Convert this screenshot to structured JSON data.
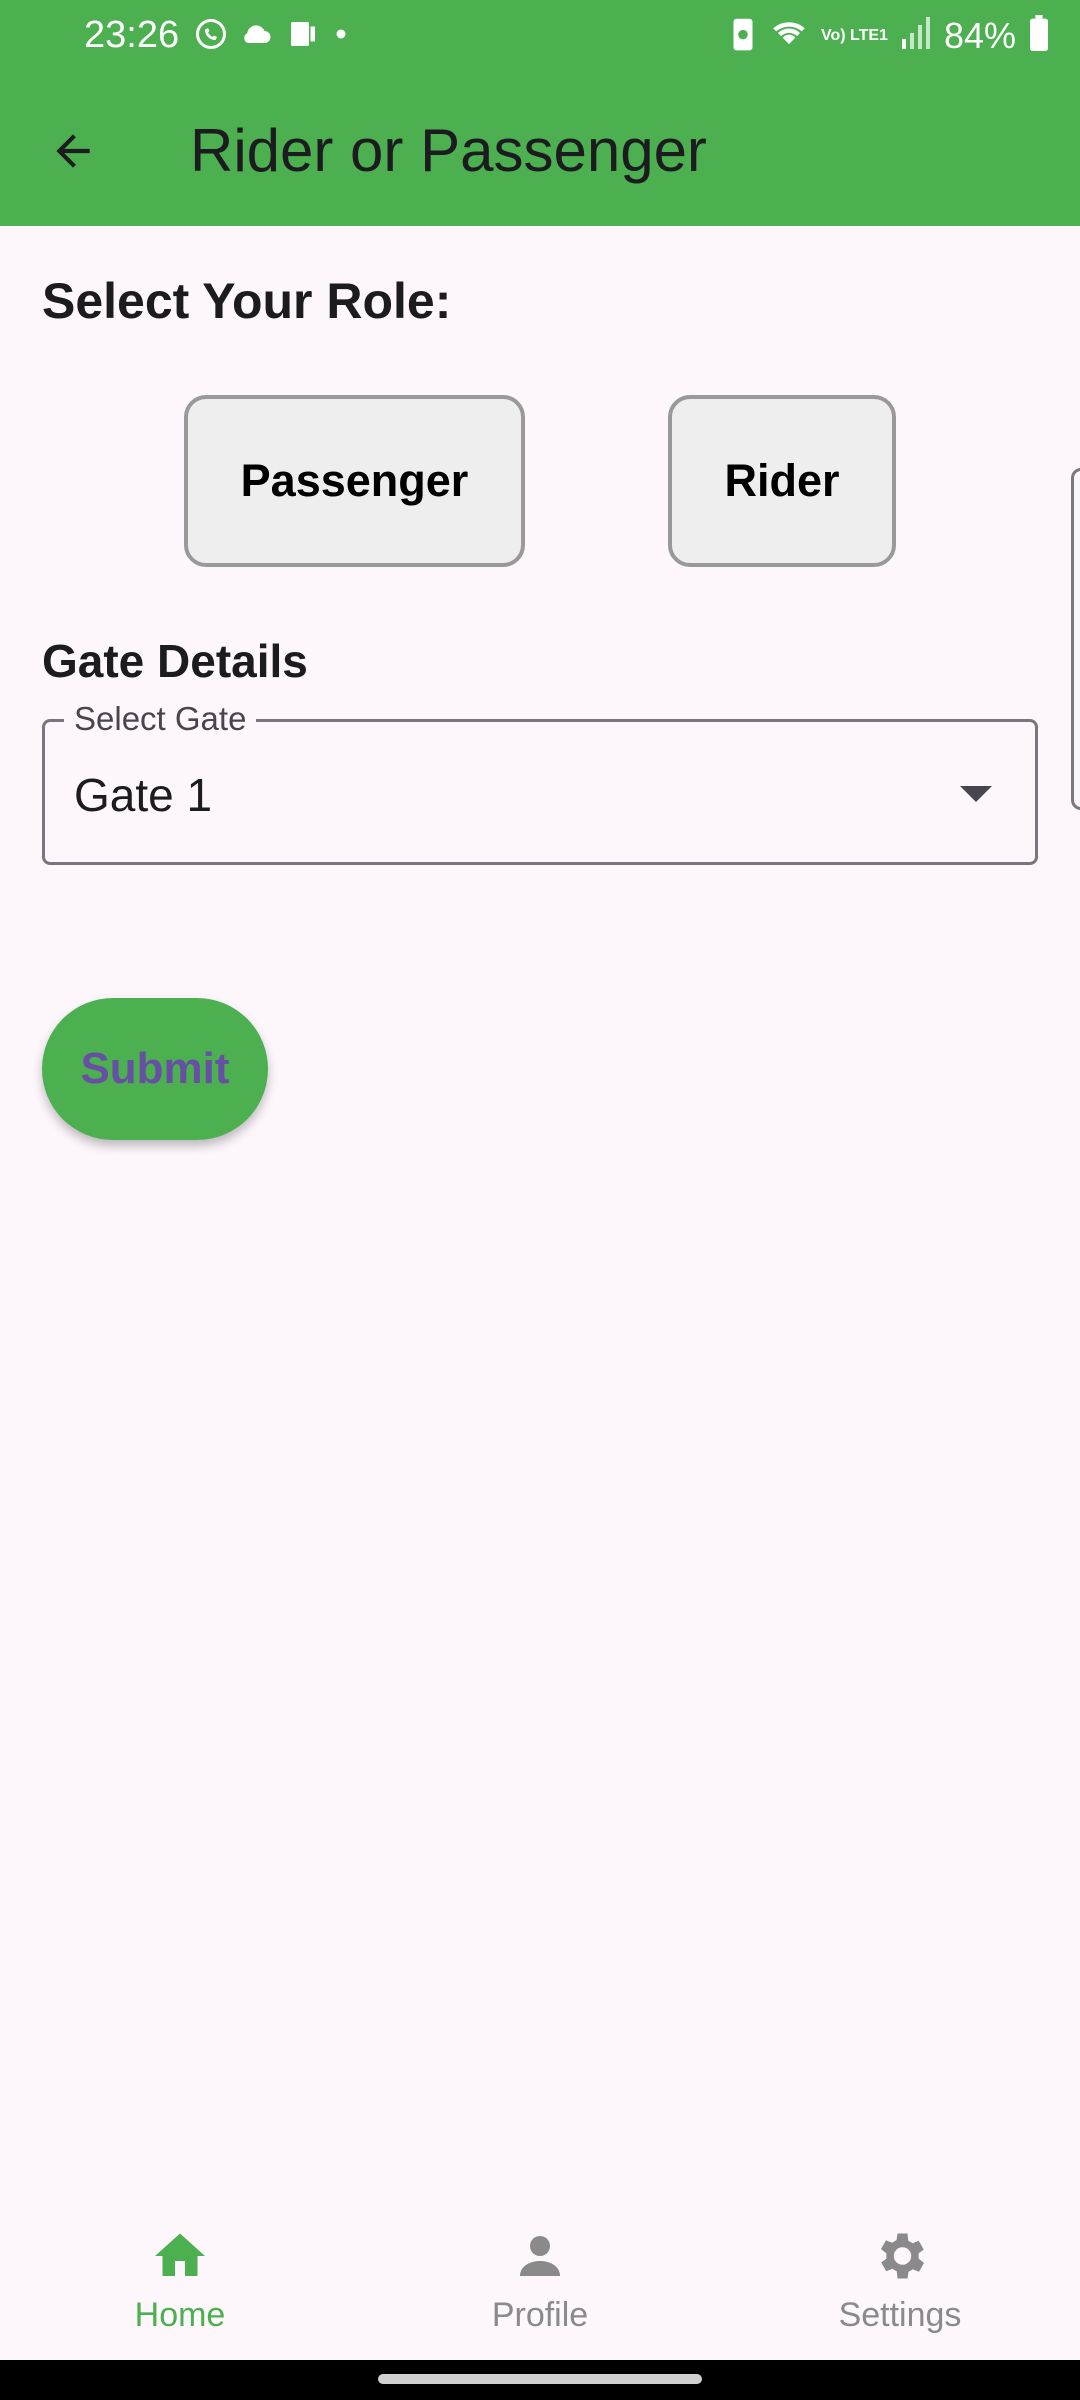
{
  "status_bar": {
    "time": "23:26",
    "battery": "84%",
    "icons_left": [
      "whatsapp-icon",
      "cloud-icon",
      "device-icon",
      "dot-icon"
    ],
    "icons_right": [
      "battery-saver-icon",
      "wifi-icon",
      "volte-icon",
      "signal-icon",
      "battery-icon"
    ],
    "volte_text": "Vo) LTE1"
  },
  "app_bar": {
    "title": "Rider or Passenger",
    "back_icon": "back-arrow-icon",
    "color": "#4caf50"
  },
  "role_section": {
    "heading": "Select Your Role:",
    "options": [
      {
        "label": "Passenger"
      },
      {
        "label": "Rider"
      }
    ]
  },
  "gate_section": {
    "heading": "Gate Details",
    "field_label": "Select Gate",
    "selected_value": "Gate 1",
    "dropdown_icon": "dropdown-arrow-icon"
  },
  "submit": {
    "label": "Submit",
    "color": "#4caf50",
    "text_color": "#6750a4"
  },
  "bottom_nav": {
    "items": [
      {
        "label": "Home",
        "icon": "home-icon",
        "active": true
      },
      {
        "label": "Profile",
        "icon": "person-icon",
        "active": false
      },
      {
        "label": "Settings",
        "icon": "gear-icon",
        "active": false
      }
    ],
    "active_color": "#4caf50",
    "inactive_color": "#8a8a8a"
  }
}
